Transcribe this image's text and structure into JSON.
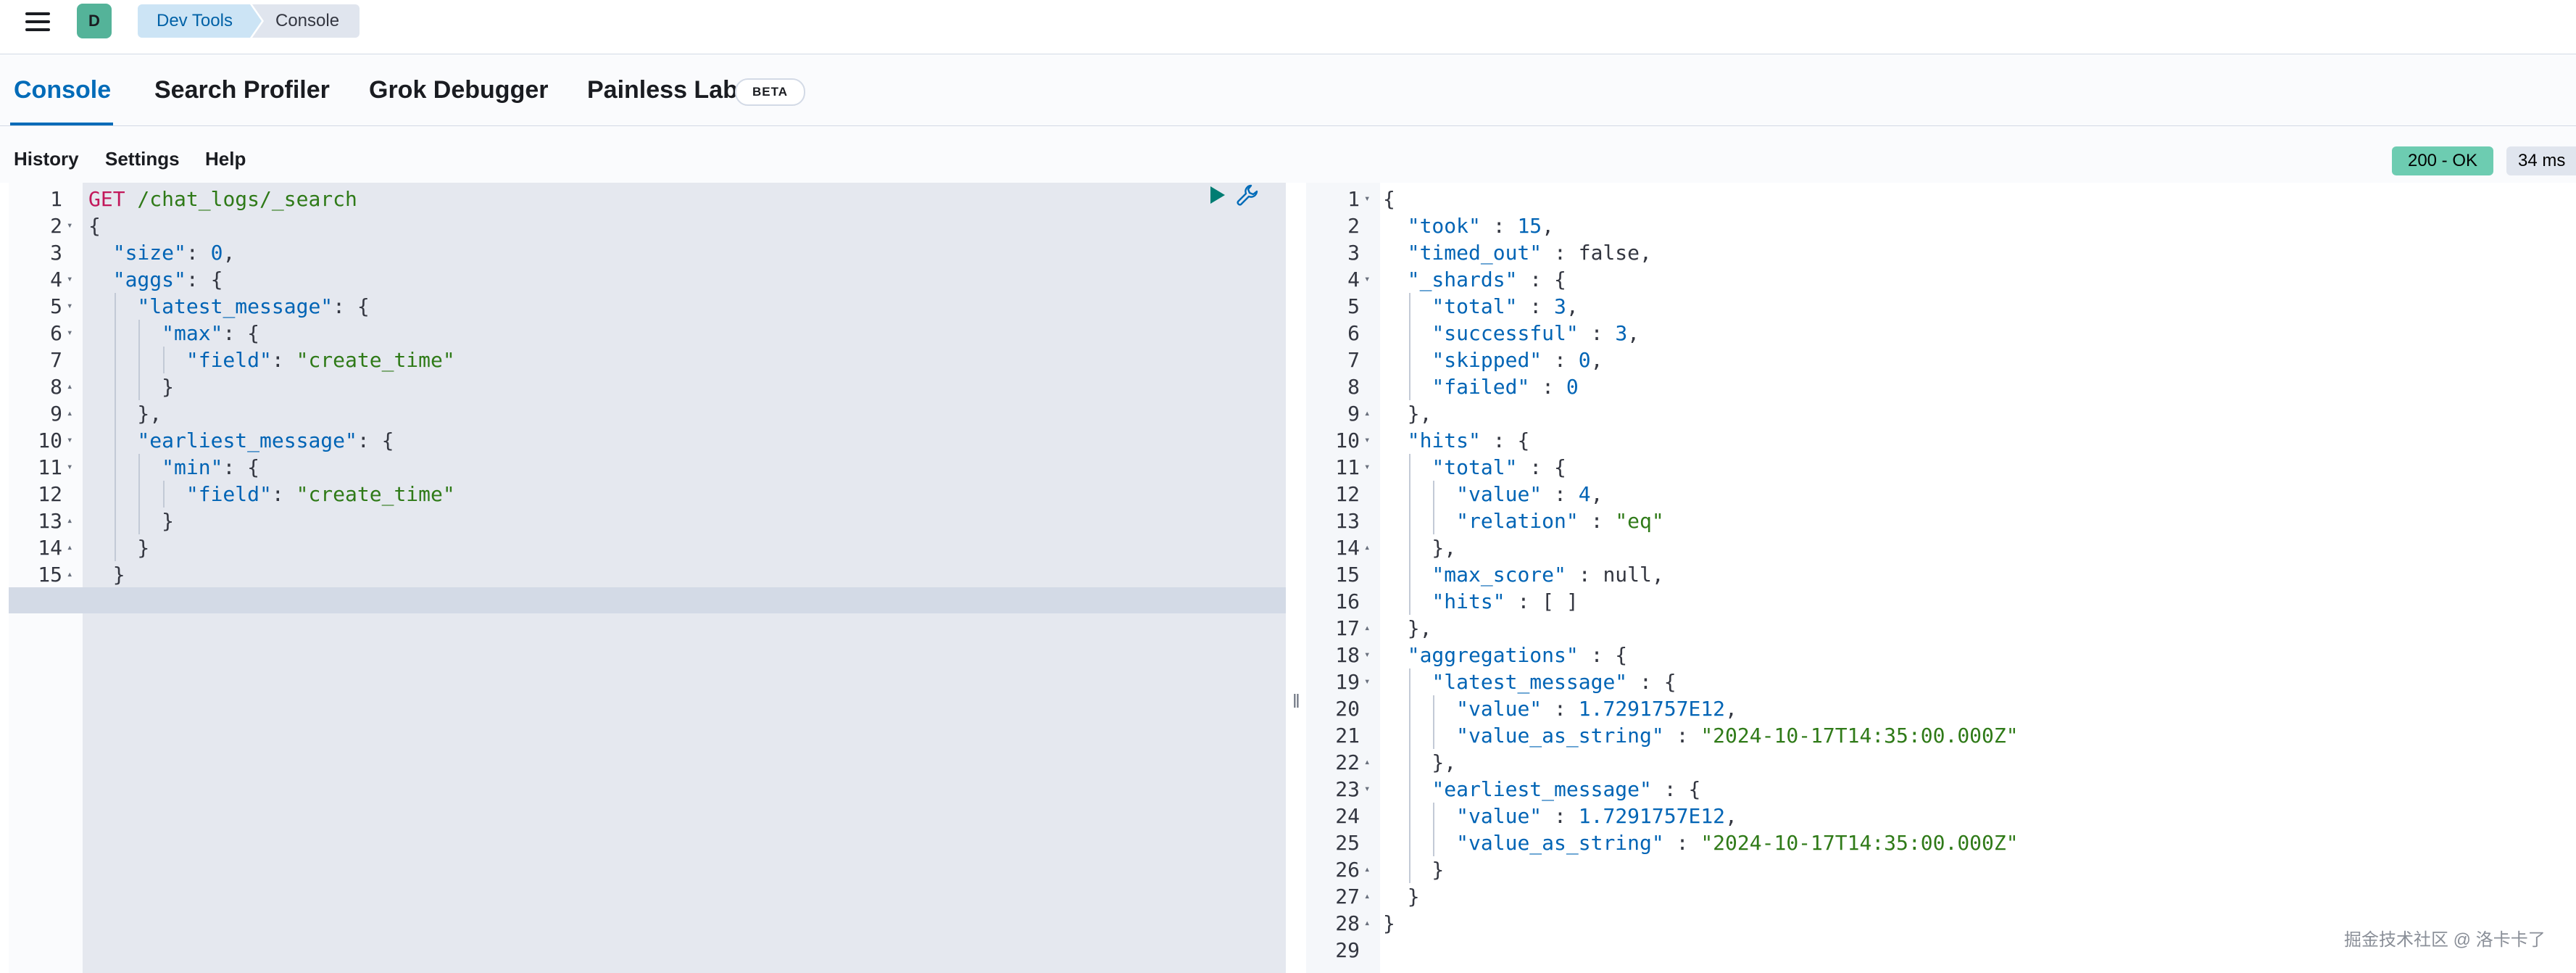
{
  "topbar": {
    "avatar_letter": "D",
    "breadcrumbs": [
      "Dev Tools",
      "Console"
    ]
  },
  "tabs": [
    {
      "label": "Console",
      "active": true
    },
    {
      "label": "Search Profiler"
    },
    {
      "label": "Grok Debugger"
    },
    {
      "label": "Painless Lab",
      "badge": "BETA"
    }
  ],
  "menu": {
    "items": [
      "History",
      "Settings",
      "Help"
    ],
    "status": "200 - OK",
    "took": "34 ms"
  },
  "request": {
    "method": "GET",
    "path": " /chat_logs/_search",
    "lines": [
      "GET /chat_logs/_search",
      "{",
      "  \"size\": 0,",
      "  \"aggs\": {",
      "    \"latest_message\": {",
      "      \"max\": {",
      "        \"field\": \"create_time\"",
      "      }",
      "    },",
      "    \"earliest_message\": {",
      "      \"min\": {",
      "        \"field\": \"create_time\"",
      "      }",
      "    }",
      "  }",
      "}"
    ]
  },
  "response": {
    "lines": [
      "{",
      "  \"took\" : 15,",
      "  \"timed_out\" : false,",
      "  \"_shards\" : {",
      "    \"total\" : 3,",
      "    \"successful\" : 3,",
      "    \"skipped\" : 0,",
      "    \"failed\" : 0",
      "  },",
      "  \"hits\" : {",
      "    \"total\" : {",
      "      \"value\" : 4,",
      "      \"relation\" : \"eq\"",
      "    },",
      "    \"max_score\" : null,",
      "    \"hits\" : [ ]",
      "  },",
      "  \"aggregations\" : {",
      "    \"latest_message\" : {",
      "      \"value\" : 1.7291757E12,",
      "      \"value_as_string\" : \"2024-10-17T14:35:00.000Z\"",
      "    },",
      "    \"earliest_message\" : {",
      "      \"value\" : 1.7291757E12,",
      "      \"value_as_string\" : \"2024-10-17T14:35:00.000Z\"",
      "    }",
      "  }",
      "}",
      ""
    ]
  },
  "watermark": "掘金技术社区 @ 洛卡卡了",
  "icons": {
    "menu": "hamburger-icon",
    "run": "play-icon",
    "wrench": "wrench-icon"
  }
}
